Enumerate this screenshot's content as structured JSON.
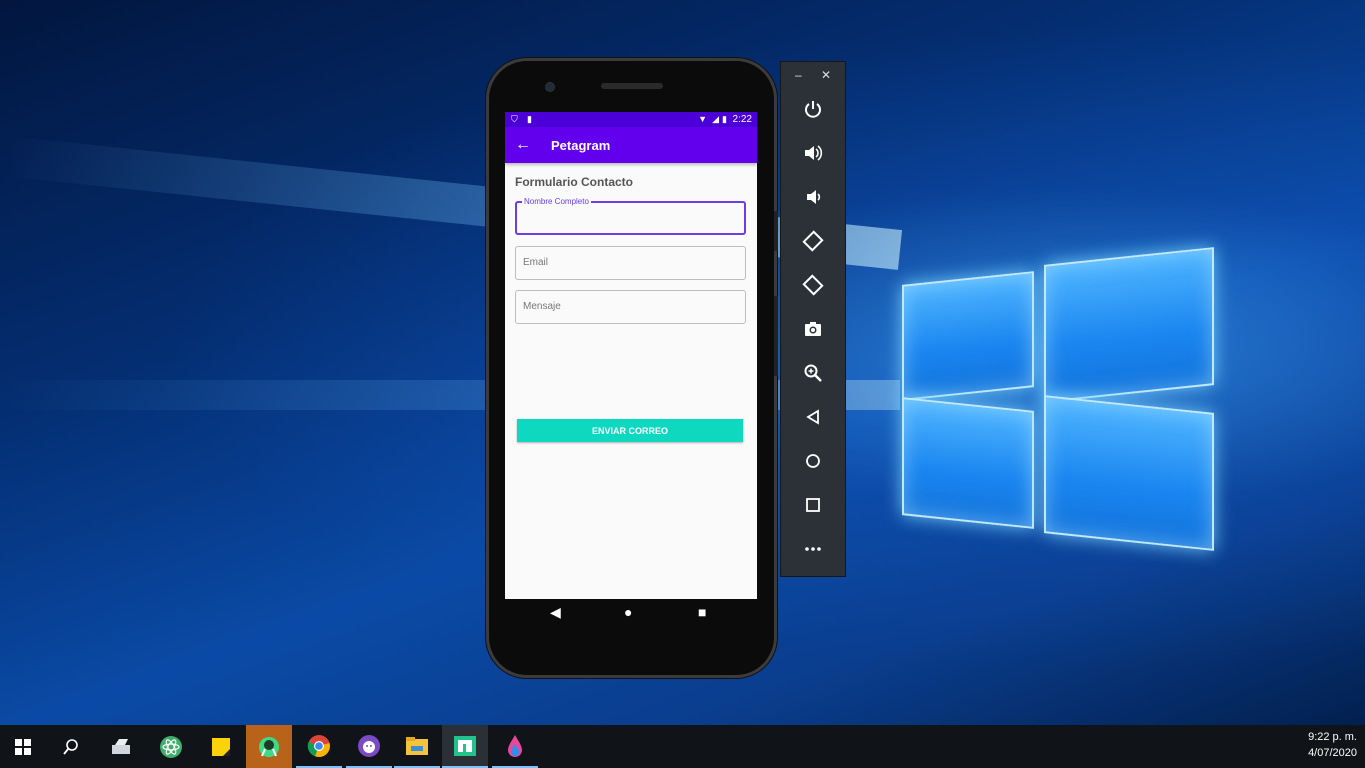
{
  "app": {
    "title": "Petagram",
    "status_time": "2:22",
    "form_title": "Formulario Contacto",
    "fields": {
      "name_label": "Nombre Completo",
      "name_value": "",
      "email_placeholder": "Email",
      "message_placeholder": "Mensaje"
    },
    "send_button": "ENVIAR CORREO"
  },
  "emulator_toolbar": {
    "minimize": "–",
    "close": "✕",
    "tools": [
      "power-icon",
      "volume-up-icon",
      "volume-down-icon",
      "rotate-left-icon",
      "rotate-right-icon",
      "camera-icon",
      "zoom-icon",
      "back-icon",
      "home-icon",
      "overview-icon",
      "more-icon"
    ]
  },
  "taskbar": {
    "items": [
      "start-icon",
      "search-icon",
      "scanner-app-icon",
      "atom-app-icon",
      "sticky-notes-icon",
      "android-studio-icon",
      "chrome-icon",
      "github-desktop-icon",
      "file-explorer-icon",
      "app-icon",
      "paint-drop-icon"
    ],
    "time": "9:22 p. m.",
    "date": "4/07/2020"
  }
}
